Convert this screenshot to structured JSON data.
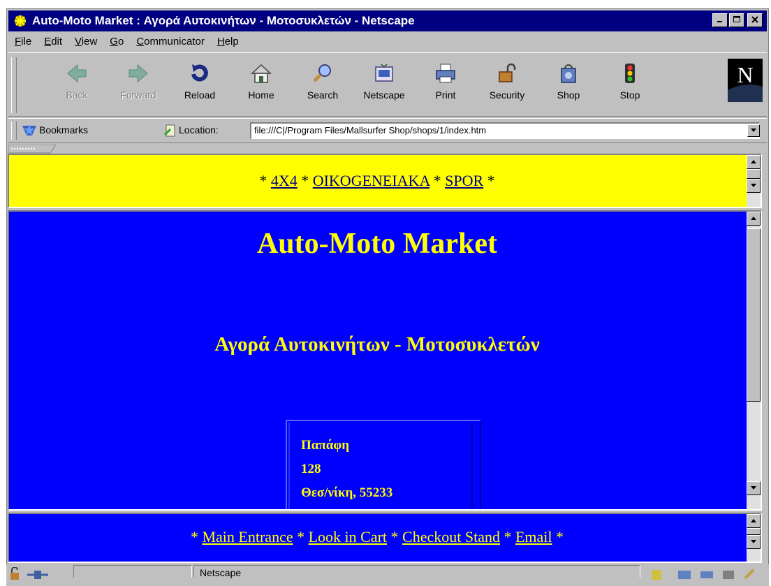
{
  "window": {
    "title": "Auto-Moto Market : Αγορά Αυτοκινήτων - Μοτοσυκλετών - Netscape",
    "controls": [
      "_",
      "□",
      "×"
    ]
  },
  "menu": [
    "File",
    "Edit",
    "View",
    "Go",
    "Communicator",
    "Help"
  ],
  "toolbar": {
    "buttons": [
      {
        "label": "Back",
        "icon": "back-arrow-icon",
        "enabled": false
      },
      {
        "label": "Forward",
        "icon": "forward-arrow-icon",
        "enabled": false
      },
      {
        "label": "Reload",
        "icon": "reload-icon",
        "enabled": true
      },
      {
        "label": "Home",
        "icon": "home-icon",
        "enabled": true
      },
      {
        "label": "Search",
        "icon": "search-icon",
        "enabled": true
      },
      {
        "label": "Netscape",
        "icon": "netscape-icon",
        "enabled": true
      },
      {
        "label": "Print",
        "icon": "printer-icon",
        "enabled": true
      },
      {
        "label": "Security",
        "icon": "padlock-icon",
        "enabled": true
      },
      {
        "label": "Shop",
        "icon": "shopping-bag-icon",
        "enabled": true
      },
      {
        "label": "Stop",
        "icon": "stop-light-icon",
        "enabled": true
      }
    ],
    "logo": "N"
  },
  "location_bar": {
    "bookmarks_label": "Bookmarks",
    "location_label": "Location:",
    "url": "file:///C|/Program Files/Mallsurfer Shop/shops/1/index.htm"
  },
  "top_frame": {
    "sep": "*",
    "links": [
      "4X4",
      "OIKOGENEIAKA",
      "SPOR"
    ]
  },
  "main_frame": {
    "title": "Auto-Moto Market",
    "subtitle": "Αγορά Αυτοκινήτων - Μοτοσυκλετών",
    "address": {
      "street": "Παπάφη",
      "number": "128",
      "city": "Θεσ/νίκη, 55233"
    }
  },
  "bottom_frame": {
    "sep": "*",
    "links": [
      "Main Entrance",
      "Look in Cart",
      "Checkout Stand",
      "Email"
    ]
  },
  "status": {
    "text": "Netscape"
  },
  "colors": {
    "title_bar": "#000080",
    "top_frame_bg": "#ffff00",
    "main_bg": "#0000ff",
    "heading_text": "#ffff00"
  }
}
